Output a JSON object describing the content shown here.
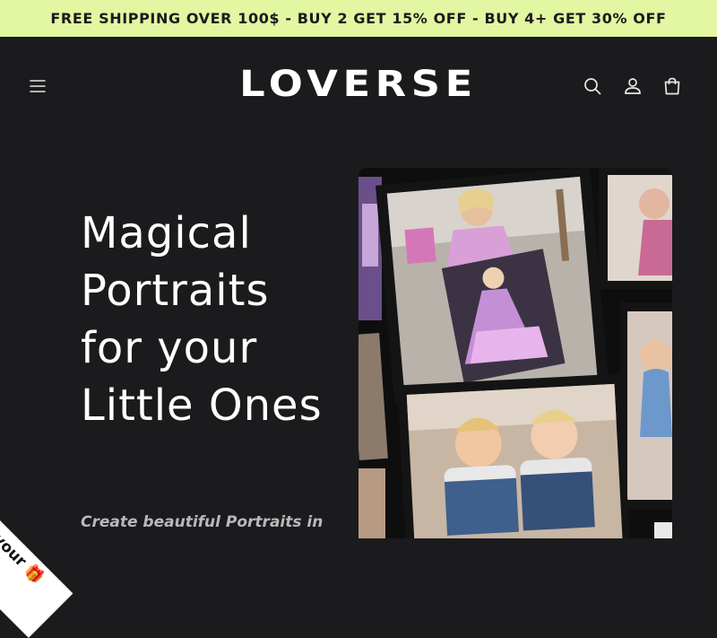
{
  "announcement": {
    "text": "FREE SHIPPING OVER 100$ - BUY 2 GET 15% OFF - BUY 4+ GET 30% OFF"
  },
  "header": {
    "logo_text": "LOVERSE",
    "icons": {
      "menu": "menu-icon",
      "search": "search-icon",
      "account": "user-icon",
      "cart": "shopping-bag-icon"
    }
  },
  "hero": {
    "title_lines": [
      "Magical",
      "Portraits",
      "for your",
      "Little Ones"
    ],
    "subtitle": "Create beautiful Portraits in",
    "image_alt": "collage of framed children portraits"
  },
  "claim_tab": {
    "label": "Claim your 🎁"
  },
  "colors": {
    "background": "#1b1b1d",
    "announcement_bg": "#e3f6a1",
    "text_primary": "#ffffff",
    "text_muted": "#b9b9bb"
  }
}
